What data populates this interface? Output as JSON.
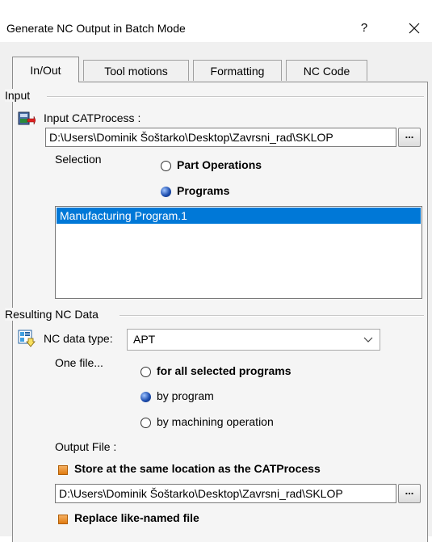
{
  "window": {
    "title": "Generate NC Output in Batch Mode",
    "help_glyph": "?",
    "close_glyph": "✕"
  },
  "tabs": [
    {
      "label": "In/Out",
      "active": true
    },
    {
      "label": "Tool motions",
      "active": false
    },
    {
      "label": "Formatting",
      "active": false
    },
    {
      "label": "NC Code",
      "active": false
    }
  ],
  "input_section": {
    "title": "Input",
    "catprocess_label": "Input CATProcess :",
    "catprocess_path": "D:\\Users\\Dominik Šoštarko\\Desktop\\Zavrsni_rad\\SKLOP",
    "browse_label": "...",
    "selection_label": "Selection",
    "option_part_operations": "Part Operations",
    "option_programs": "Programs",
    "selected_option": "Programs",
    "list_items": [
      "Manufacturing Program.1"
    ]
  },
  "output_section": {
    "title": "Resulting NC Data",
    "nc_type_label": "NC data type:",
    "nc_type_value": "APT",
    "one_file_label": "One file...",
    "option_all_programs": "for all selected programs",
    "option_by_program": "by program",
    "option_by_operation": "by machining operation",
    "selected_option": "by program",
    "output_file_label": "Output File :",
    "store_same_location_label": "Store at the same location as the CATProcess",
    "store_same_location_checked": true,
    "output_path": "D:\\Users\\Dominik Šoštarko\\Desktop\\Zavrsni_rad\\SKLOP",
    "browse_label": "...",
    "replace_label": "Replace like-named file",
    "replace_checked": true
  },
  "colors": {
    "selection": "#0078d7",
    "check_fill": "#e07b10",
    "dialog_bg": "#f0f0f0"
  }
}
